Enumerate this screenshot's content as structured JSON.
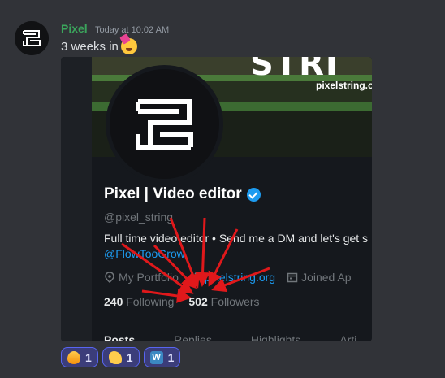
{
  "message": {
    "username": "Pixel",
    "timestamp": "Today at 10:02 AM",
    "content_text": "3 weeks in"
  },
  "embed": {
    "banner_title": "STRI",
    "banner_url": "pixelstring.org",
    "display_name": "Pixel | Video editor",
    "handle": "@pixel_string",
    "bio": "Full time video editor • Send me a DM and let's get s",
    "bio_link": "@FlowTooGrow",
    "meta": {
      "portfolio_label": "My Portfolio",
      "website_link": "pixelstring.org",
      "joined_label": "Joined Ap"
    },
    "stats": {
      "following_count": "240",
      "following_label": "Following",
      "followers_count": "502",
      "followers_label": "Followers"
    },
    "tabs": [
      "Posts",
      "Replies",
      "Highlights",
      "Arti"
    ]
  },
  "reactions": [
    {
      "icon": "fire-emoji",
      "count": "1"
    },
    {
      "icon": "flexed-biceps-emoji",
      "count": "1"
    },
    {
      "icon": "w-emoji",
      "count": "1"
    }
  ],
  "colors": {
    "background": "#313338",
    "username": "#3ba55c",
    "link": "#1d9bf0",
    "arrow": "#e0181b",
    "reaction_border": "#5865f2"
  }
}
